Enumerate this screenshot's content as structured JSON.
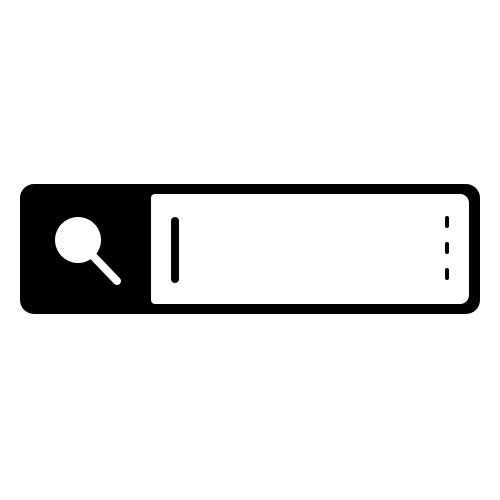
{
  "search": {
    "value": "",
    "icon": "search-icon"
  },
  "colors": {
    "frame": "#000000",
    "field": "#ffffff"
  }
}
